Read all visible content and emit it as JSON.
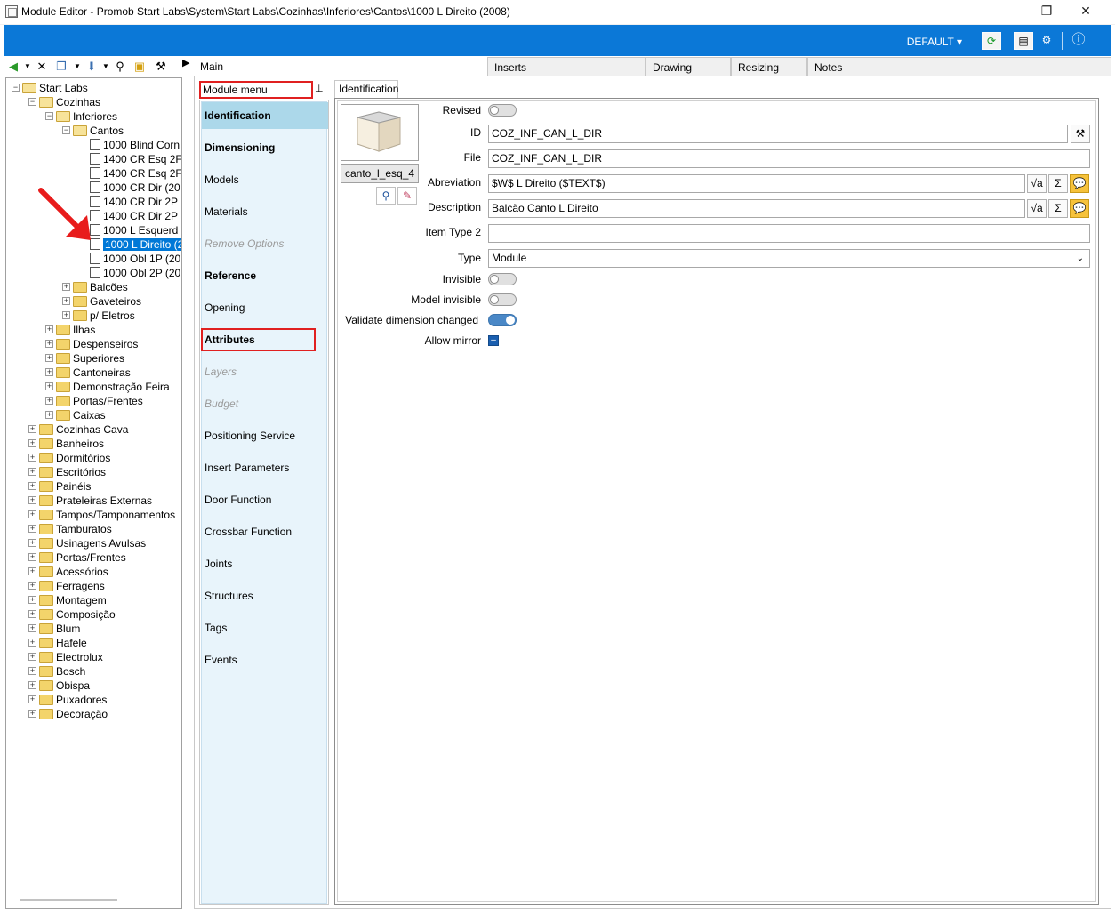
{
  "window": {
    "title": "Module Editor - Promob Start Labs\\System\\Start Labs\\Cozinhas\\Inferiores\\Cantos\\1000 L Direito (2008)",
    "minimize_icon": "minimize-icon",
    "restore_icon": "restore-icon",
    "close_icon": "close-icon"
  },
  "header": {
    "profile_label": "DEFAULT",
    "brand_color": "#0b78d7"
  },
  "tree_toolbar": [
    "back-icon",
    "delete-icon",
    "copy-icon",
    "dropdown-icon",
    "search-icon",
    "folder-icon",
    "tool-icon"
  ],
  "tree": {
    "nodes": [
      {
        "label": "Start Labs",
        "level": 0,
        "kind": "folder-open",
        "exp": "−"
      },
      {
        "label": "Cozinhas",
        "level": 1,
        "kind": "folder-open",
        "exp": "−"
      },
      {
        "label": "Inferiores",
        "level": 2,
        "kind": "folder-open",
        "exp": "−"
      },
      {
        "label": "Cantos",
        "level": 3,
        "kind": "folder-open",
        "exp": "−"
      },
      {
        "label": "1000 Blind Corn",
        "level": 4,
        "kind": "doc"
      },
      {
        "label": "1400 CR Esq 2F",
        "level": 4,
        "kind": "doc"
      },
      {
        "label": "1400 CR Esq 2F",
        "level": 4,
        "kind": "doc"
      },
      {
        "label": "1000 CR Dir (20",
        "level": 4,
        "kind": "doc"
      },
      {
        "label": "1400 CR Dir 2P",
        "level": 4,
        "kind": "doc"
      },
      {
        "label": "1400 CR Dir 2P",
        "level": 4,
        "kind": "doc"
      },
      {
        "label": "1000 L Esquerd",
        "level": 4,
        "kind": "doc"
      },
      {
        "label": "1000 L Direito (2",
        "level": 4,
        "kind": "doc",
        "selected": true
      },
      {
        "label": "1000 Obl 1P (20",
        "level": 4,
        "kind": "doc"
      },
      {
        "label": "1000 Obl 2P (20",
        "level": 4,
        "kind": "doc"
      },
      {
        "label": "Balcões",
        "level": 3,
        "kind": "folder",
        "exp": "+"
      },
      {
        "label": "Gaveteiros",
        "level": 3,
        "kind": "folder",
        "exp": "+"
      },
      {
        "label": "p/ Eletros",
        "level": 3,
        "kind": "folder",
        "exp": "+"
      },
      {
        "label": "Ilhas",
        "level": 2,
        "kind": "folder",
        "exp": "+"
      },
      {
        "label": "Despenseiros",
        "level": 2,
        "kind": "folder",
        "exp": "+"
      },
      {
        "label": "Superiores",
        "level": 2,
        "kind": "folder",
        "exp": "+"
      },
      {
        "label": "Cantoneiras",
        "level": 2,
        "kind": "folder",
        "exp": "+"
      },
      {
        "label": "Demonstração Feira",
        "level": 2,
        "kind": "folder",
        "exp": "+"
      },
      {
        "label": "Portas/Frentes",
        "level": 2,
        "kind": "folder",
        "exp": "+"
      },
      {
        "label": "Caixas",
        "level": 2,
        "kind": "folder",
        "exp": "+"
      },
      {
        "label": "Cozinhas Cava",
        "level": 1,
        "kind": "folder",
        "exp": "+"
      },
      {
        "label": "Banheiros",
        "level": 1,
        "kind": "folder",
        "exp": "+"
      },
      {
        "label": "Dormitórios",
        "level": 1,
        "kind": "folder",
        "exp": "+"
      },
      {
        "label": "Escritórios",
        "level": 1,
        "kind": "folder",
        "exp": "+"
      },
      {
        "label": "Painéis",
        "level": 1,
        "kind": "folder",
        "exp": "+"
      },
      {
        "label": "Prateleiras Externas",
        "level": 1,
        "kind": "folder",
        "exp": "+"
      },
      {
        "label": "Tampos/Tamponamentos",
        "level": 1,
        "kind": "folder",
        "exp": "+"
      },
      {
        "label": "Tamburatos",
        "level": 1,
        "kind": "folder",
        "exp": "+"
      },
      {
        "label": "Usinagens Avulsas",
        "level": 1,
        "kind": "folder",
        "exp": "+"
      },
      {
        "label": "Portas/Frentes",
        "level": 1,
        "kind": "folder",
        "exp": "+"
      },
      {
        "label": "Acessórios",
        "level": 1,
        "kind": "folder",
        "exp": "+"
      },
      {
        "label": "Ferragens",
        "level": 1,
        "kind": "folder",
        "exp": "+"
      },
      {
        "label": "Montagem",
        "level": 1,
        "kind": "folder",
        "exp": "+"
      },
      {
        "label": "Composição",
        "level": 1,
        "kind": "folder",
        "exp": "+"
      },
      {
        "label": "Blum",
        "level": 1,
        "kind": "folder",
        "exp": "+"
      },
      {
        "label": "Hafele",
        "level": 1,
        "kind": "folder",
        "exp": "+"
      },
      {
        "label": "Electrolux",
        "level": 1,
        "kind": "folder",
        "exp": "+"
      },
      {
        "label": "Bosch",
        "level": 1,
        "kind": "folder",
        "exp": "+"
      },
      {
        "label": "Obispa",
        "level": 1,
        "kind": "folder",
        "exp": "+"
      },
      {
        "label": "Puxadores",
        "level": 1,
        "kind": "folder",
        "exp": "+"
      },
      {
        "label": "Decoração",
        "level": 1,
        "kind": "folder",
        "exp": "+"
      }
    ]
  },
  "main_tabs": {
    "main": "Main",
    "inserts": "Inserts",
    "drawing": "Drawing",
    "resizing": "Resizing",
    "notes": "Notes"
  },
  "module_menu": {
    "title": "Module menu",
    "items": [
      {
        "label": "Identification",
        "style": "bold active"
      },
      {
        "label": "Dimensioning",
        "style": "bold"
      },
      {
        "label": "Models",
        "style": ""
      },
      {
        "label": "Materials",
        "style": ""
      },
      {
        "label": "Remove Options",
        "style": "disabled"
      },
      {
        "label": "Reference",
        "style": "bold"
      },
      {
        "label": "Opening",
        "style": ""
      },
      {
        "label": "Attributes",
        "style": "bold"
      },
      {
        "label": "Layers",
        "style": "disabled"
      },
      {
        "label": "Budget",
        "style": "disabled"
      },
      {
        "label": "Positioning Service",
        "style": ""
      },
      {
        "label": "Insert Parameters",
        "style": ""
      },
      {
        "label": "Door Function",
        "style": ""
      },
      {
        "label": "Crossbar Function",
        "style": ""
      },
      {
        "label": "Joints",
        "style": ""
      },
      {
        "label": "Structures",
        "style": ""
      },
      {
        "label": "Tags",
        "style": ""
      },
      {
        "label": "Events",
        "style": ""
      }
    ]
  },
  "identification": {
    "tab_label": "Identification",
    "preview_name": "canto_l_esq_4",
    "fields": {
      "revised_label": "Revised",
      "id_label": "ID",
      "id_value": "COZ_INF_CAN_L_DIR",
      "file_label": "File",
      "file_value": "COZ_INF_CAN_L_DIR",
      "abreviation_label": "Abreviation",
      "abreviation_value": "$W$ L Direito ($TEXT$)",
      "description_label": "Description",
      "description_value": "Balcão Canto L Direito",
      "item_type2_label": "Item Type 2",
      "item_type2_value": "",
      "type_label": "Type",
      "type_value": "Module",
      "invisible_label": "Invisible",
      "model_invisible_label": "Model invisible",
      "validate_dimension_label": "Validate dimension changed",
      "allow_mirror_label": "Allow mirror"
    }
  }
}
